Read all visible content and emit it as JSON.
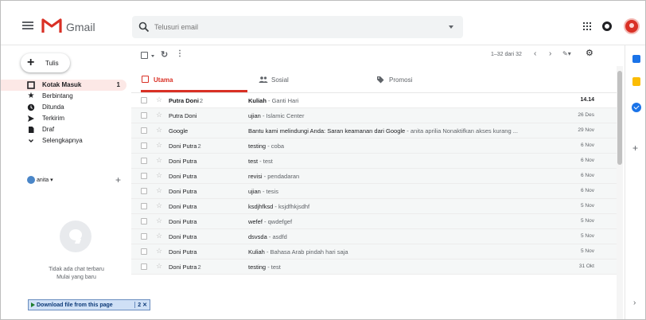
{
  "header": {
    "app_title": "Gmail",
    "search_placeholder": "Telusuri email"
  },
  "sidebar": {
    "compose_label": "Tulis",
    "items": [
      {
        "label": "Kotak Masuk",
        "count": "1",
        "icon": "inbox-icon",
        "active": true
      },
      {
        "label": "Berbintang",
        "count": "",
        "icon": "star-icon",
        "active": false
      },
      {
        "label": "Ditunda",
        "count": "",
        "icon": "clock-icon",
        "active": false
      },
      {
        "label": "Terkirim",
        "count": "",
        "icon": "send-icon",
        "active": false
      },
      {
        "label": "Draf",
        "count": "",
        "icon": "draft-icon",
        "active": false
      },
      {
        "label": "Selengkapnya",
        "count": "",
        "icon": "chevron-down-icon",
        "active": false
      }
    ],
    "account_name": "anita",
    "chat_empty_line1": "Tidak ada chat terbaru",
    "chat_empty_line2": "Mulai yang baru",
    "download_label": "Download file from this page",
    "download_aux": "2 ✕"
  },
  "toolbar": {
    "range": "1–32 dari 32"
  },
  "tabs": [
    {
      "label": "Utama",
      "icon": "inbox-icon"
    },
    {
      "label": "Sosial",
      "icon": "people-icon"
    },
    {
      "label": "Promosi",
      "icon": "tag-icon"
    }
  ],
  "messages": [
    {
      "sender": "Putra Doni",
      "count": "2",
      "subject": "Kuliah",
      "snippet": "Ganti Hari",
      "date": "14.14",
      "unread": true
    },
    {
      "sender": "Putra Doni",
      "count": "",
      "subject": "ujian",
      "snippet": "Islamic Center",
      "date": "26 Des",
      "unread": false
    },
    {
      "sender": "Google",
      "count": "",
      "subject": "Bantu kami melindungi Anda: Saran keamanan dari Google",
      "snippet": "anita aprilia Nonaktifkan akses kurang ...",
      "date": "29 Nov",
      "unread": false
    },
    {
      "sender": "Doni Putra",
      "count": "2",
      "subject": "testing",
      "snippet": "coba",
      "date": "6 Nov",
      "unread": false
    },
    {
      "sender": "Doni Putra",
      "count": "",
      "subject": "test",
      "snippet": "test",
      "date": "6 Nov",
      "unread": false
    },
    {
      "sender": "Doni Putra",
      "count": "",
      "subject": "revisi",
      "snippet": "pendadaran",
      "date": "6 Nov",
      "unread": false
    },
    {
      "sender": "Doni Putra",
      "count": "",
      "subject": "ujian",
      "snippet": "tesis",
      "date": "6 Nov",
      "unread": false
    },
    {
      "sender": "Doni Putra",
      "count": "",
      "subject": "ksdjhfksd",
      "snippet": "ksjdfhkjsdhf",
      "date": "5 Nov",
      "unread": false
    },
    {
      "sender": "Doni Putra",
      "count": "",
      "subject": "wefef",
      "snippet": "qwdefgef",
      "date": "5 Nov",
      "unread": false
    },
    {
      "sender": "Doni Putra",
      "count": "",
      "subject": "dsvsda",
      "snippet": "asdfd",
      "date": "5 Nov",
      "unread": false
    },
    {
      "sender": "Doni Putra",
      "count": "",
      "subject": "Kuliah",
      "snippet": "Bahasa Arab pindah hari saja",
      "date": "5 Nov",
      "unread": false
    },
    {
      "sender": "Doni Putra",
      "count": "2",
      "subject": "testing",
      "snippet": "test",
      "date": "31 Okt",
      "unread": false
    }
  ],
  "colors": {
    "brand_red": "#d93025",
    "active_bg": "#fce8e6"
  }
}
